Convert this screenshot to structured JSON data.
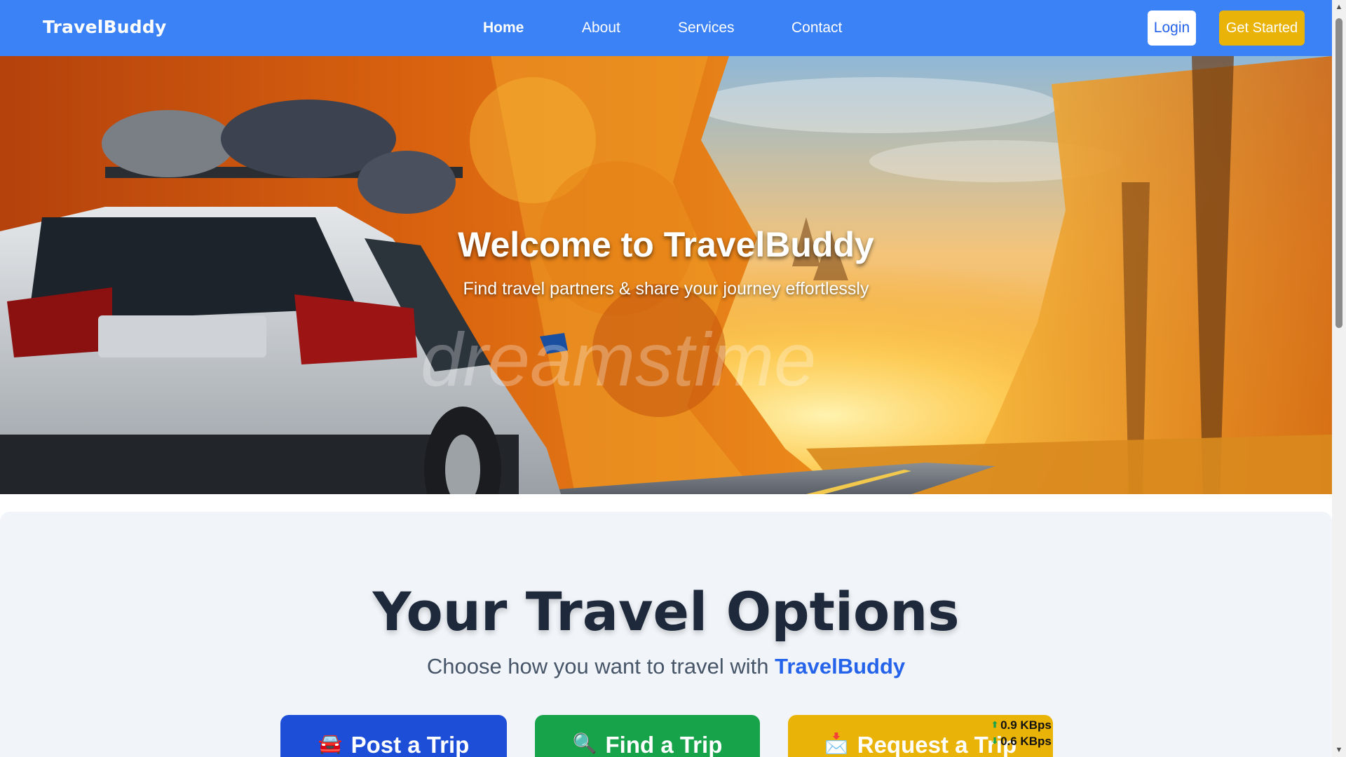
{
  "navbar": {
    "brand": "TravelBuddy",
    "links": [
      {
        "label": "Home",
        "active": true
      },
      {
        "label": "About",
        "active": false
      },
      {
        "label": "Services",
        "active": false
      },
      {
        "label": "Contact",
        "active": false
      }
    ],
    "login_label": "Login",
    "cta_label": "Get Started"
  },
  "hero": {
    "title": "Welcome to TravelBuddy",
    "subtitle": "Find travel partners & share your journey effortlessly",
    "watermark": "dreamstime"
  },
  "options": {
    "title": "Your Travel Options",
    "subtitle_prefix": "Choose how you want to travel with",
    "subtitle_highlight": "TravelBuddy",
    "buttons": [
      {
        "icon": "🚘",
        "label": "Post a Trip"
      },
      {
        "icon": "🔍",
        "label": "Find a Trip"
      },
      {
        "icon": "📩",
        "label": "Request a Trip"
      }
    ]
  },
  "network_speed": {
    "upload": "0.9 KBps",
    "download": "0.6 KBps"
  },
  "colors": {
    "nav_bg": "#3b82f6",
    "cta_yellow": "#eab308",
    "post_blue": "#1d4ed8",
    "find_green": "#16a34a",
    "heading_dark": "#1e293b",
    "section_bg": "#f1f5f9"
  }
}
